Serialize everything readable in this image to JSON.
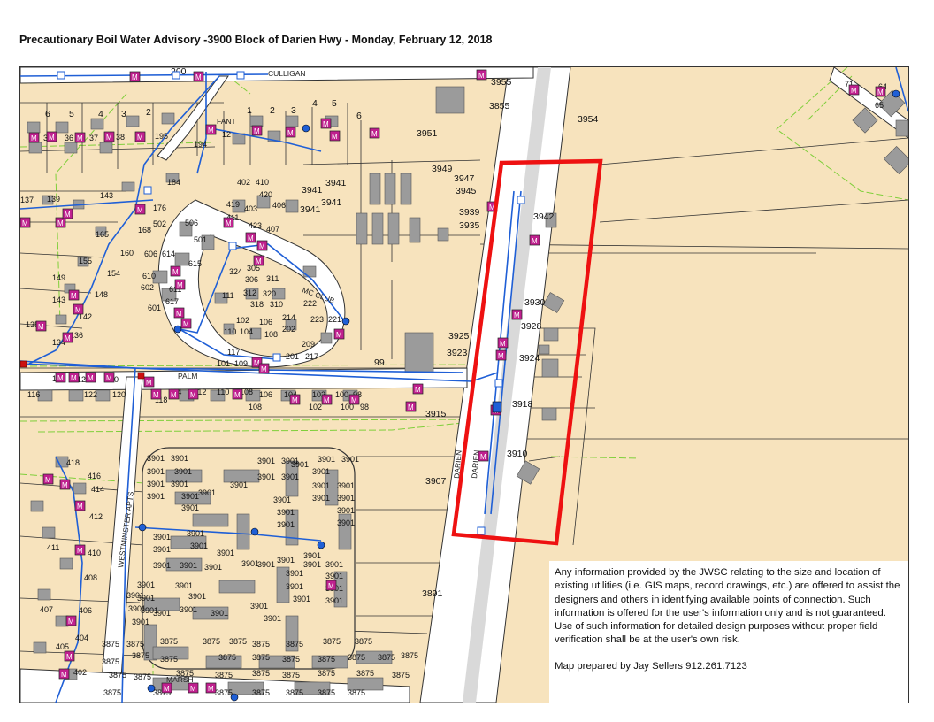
{
  "title": "Precautionary Boil Water Advisory -3900 Block of Darien Hwy - Monday, February 12, 2018",
  "map": {
    "road_labels": {
      "culligan": "CULLIGAN",
      "darien_1": "DARIEN",
      "darien_2": "DARIEN",
      "palm": "PALM",
      "westminster": "WESTMINSTER APTS",
      "marsh": "MARSH",
      "club": "MC CLUB",
      "fant": "FANT"
    },
    "addresses": {
      "a3955": "3955",
      "a3855": "3855",
      "a3954": "3954",
      "a3951": "3951",
      "a3949": "3949",
      "a3947": "3947",
      "a3945": "3945",
      "a3941a": "3941",
      "a3941b": "3941",
      "a3941c": "3941",
      "a3941d": "3941",
      "a3939": "3939",
      "a3935": "3935",
      "a3942": "3942",
      "a3930": "3930",
      "a3928": "3928",
      "a3925": "3925",
      "a3923": "3923",
      "a3924": "3924",
      "a3918": "3918",
      "a3915": "3915",
      "a3910": "3910",
      "a3907": "3907",
      "a3891": "3891",
      "a99": "99",
      "a200": "200",
      "a6": "6",
      "a5": "5",
      "a4": "4",
      "a3": "3",
      "a2": "2",
      "a1": "1",
      "a35": "35",
      "a36": "36",
      "a37": "37",
      "a38": "38",
      "a195": "195",
      "a194": "194",
      "a12": "12",
      "a71": "71",
      "a64": "64",
      "a65": "65",
      "a137": "137",
      "a139": "139",
      "a143": "143",
      "a184": "184",
      "a176": "176",
      "a402": "402",
      "a410": "410",
      "a420": "420",
      "a419": "419",
      "a403": "403",
      "a406": "406",
      "a411": "411",
      "a423": "423",
      "a407": "407",
      "a502": "502",
      "a506": "506",
      "a168": "168",
      "a165": "165",
      "a501": "501",
      "a160": "160",
      "a606": "606",
      "a614": "614",
      "a155": "155",
      "a154": "154",
      "a615": "615",
      "a610": "610",
      "a602": "602",
      "a611": "611",
      "a149": "149",
      "a148": "148",
      "a143b": "143",
      "a142": "142",
      "a601": "601",
      "a617": "617",
      "a111": "111",
      "a324": "324",
      "a305": "305",
      "a306": "306",
      "a311": "311",
      "a318": "318",
      "a312": "312",
      "a320": "320",
      "a310": "310",
      "a222": "222",
      "a135": "135",
      "a136": "136",
      "a134": "134",
      "a102": "102",
      "a106": "106",
      "a214": "214",
      "a223": "223",
      "a221": "221",
      "a110": "110",
      "a104": "104",
      "a108": "108",
      "a202": "202",
      "a209": "209",
      "a117": "117",
      "a101": "101",
      "a109": "109",
      "a201": "201",
      "a217": "217",
      "a124": "124",
      "a122": "122",
      "a120": "120",
      "a116": "116",
      "a114": "114",
      "a112": "112",
      "a118": "118",
      "a100": "100",
      "a98": "98",
      "a418": "418",
      "a416": "416",
      "a414": "414",
      "a412": "412",
      "a411b": "411",
      "a410b": "410",
      "a408": "408",
      "a407b": "407",
      "a406b": "406",
      "a404": "404",
      "a405": "405",
      "a402b": "402",
      "a3901": "3901",
      "a3875": "3875"
    }
  },
  "disclaimer": {
    "text": "Any information provided by the JWSC relating to the size and location of existing utilities (i.e. GIS maps, record drawings, etc.) are offered to assist the designers and others in identifying available points of connection. Such information is offered for the user's information only and is not guaranteed. Use of such information for detailed design purposes without proper field verification shall be at the user's own risk.",
    "credit": "Map prepared by Jay Sellers 912.261.7123"
  },
  "colors": {
    "background": "#f7e3bd",
    "road": "#ffffff",
    "water_main": "#1f5fd6",
    "meter": "#c0208f",
    "highlight": "#ee1111",
    "lot_line": "#333333",
    "greenline": "#7fcf3a",
    "building": "#9b9b9b"
  },
  "icons": [
    "meter-icon",
    "hydrant-icon",
    "valve-icon"
  ]
}
